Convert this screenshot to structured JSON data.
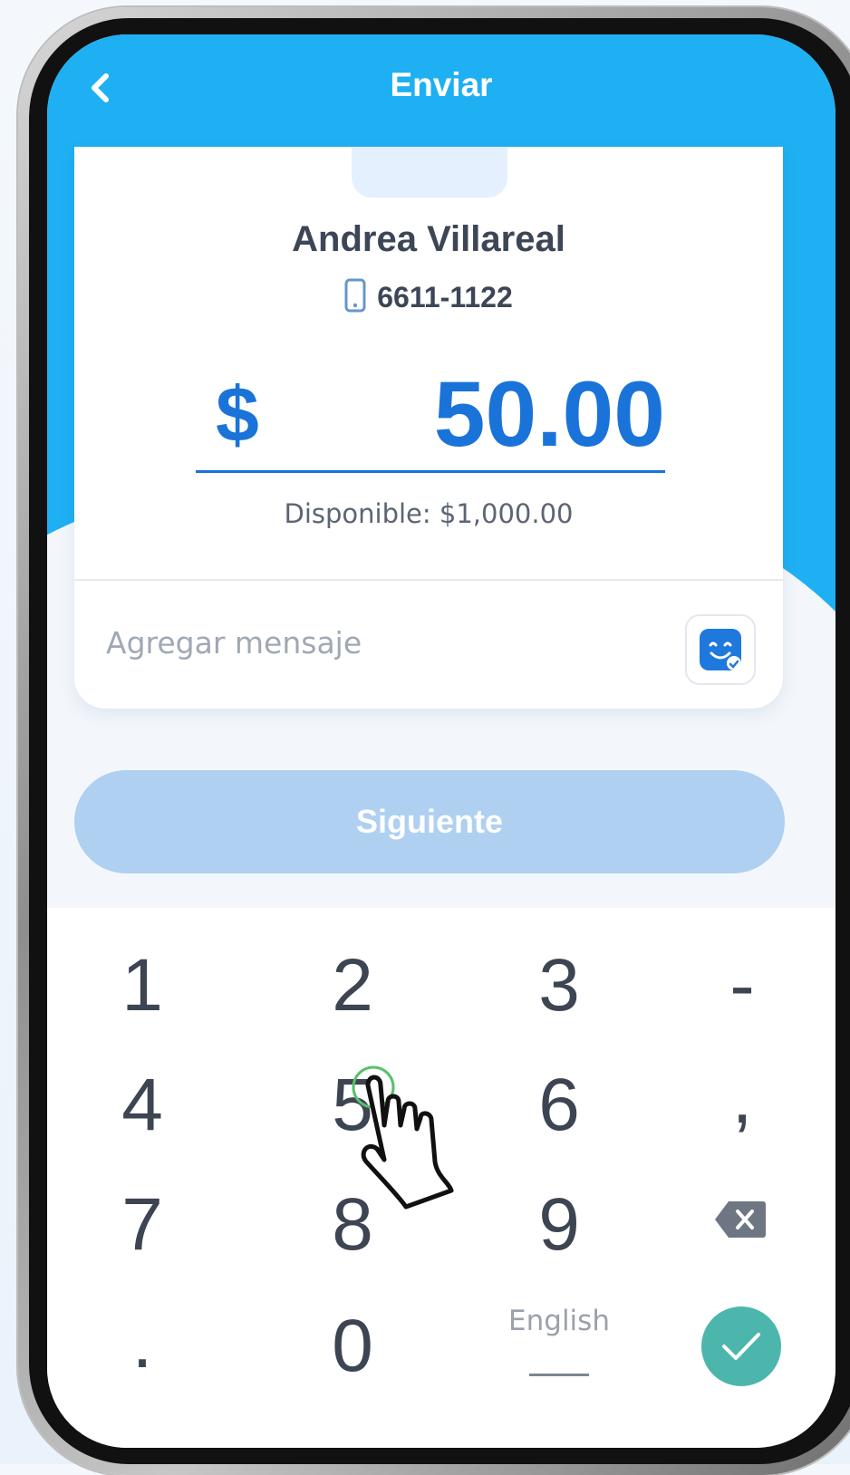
{
  "header": {
    "title": "Enviar"
  },
  "recipient": {
    "name": "Andrea Villareal",
    "phone": "6611-1122"
  },
  "amount": {
    "currency": "$",
    "value": "50.00"
  },
  "available": "Disponible: $1,000.00",
  "message": {
    "placeholder": "Agregar mensaje"
  },
  "next_button": {
    "label": "Siguiente",
    "enabled": false
  },
  "keypad": {
    "keys": [
      "1",
      "2",
      "3",
      "-",
      "4",
      "5",
      "6",
      ",",
      "7",
      "8",
      "9",
      ".",
      "0"
    ],
    "language": "English"
  },
  "colors": {
    "header": "#1fb0f3",
    "amount": "#1a73d9",
    "next_button_disabled": "#afd0f1",
    "confirm": "#4db6ac"
  },
  "icons": [
    "back-chevron-icon",
    "mobile-phone-icon",
    "sticker-icon",
    "backspace-icon",
    "check-icon",
    "hand-pointer-icon"
  ]
}
